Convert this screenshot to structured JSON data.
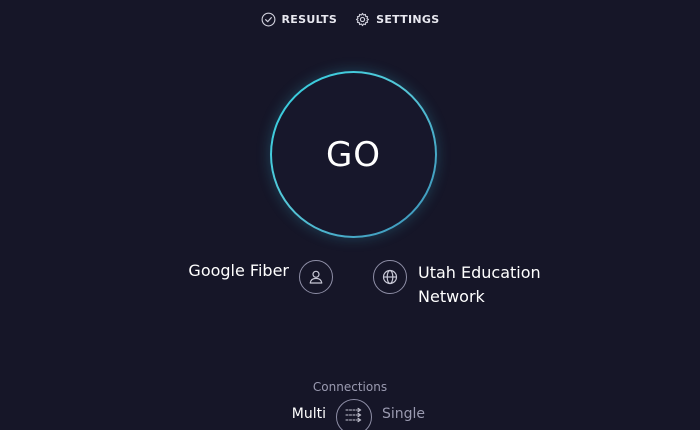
{
  "nav": {
    "results_label": "RESULTS",
    "results_icon": "check-circle-icon",
    "settings_label": "SETTINGS",
    "settings_icon": "gear-icon"
  },
  "go_button": {
    "label": "GO"
  },
  "provider": {
    "name": "Google Fiber",
    "icon": "user-icon"
  },
  "server": {
    "name_line1": "Utah Education",
    "name_line2": "Network",
    "icon": "globe-icon"
  },
  "connections": {
    "label": "Connections",
    "multi_label": "Multi",
    "single_label": "Single",
    "toggle_icon": "multi-arrows-icon",
    "selected": "Multi"
  },
  "colors": {
    "background": "#161628",
    "ring_accent": "#2ecfe0",
    "muted_text": "#9a9ab0",
    "icon_stroke": "#8e8ea6"
  }
}
